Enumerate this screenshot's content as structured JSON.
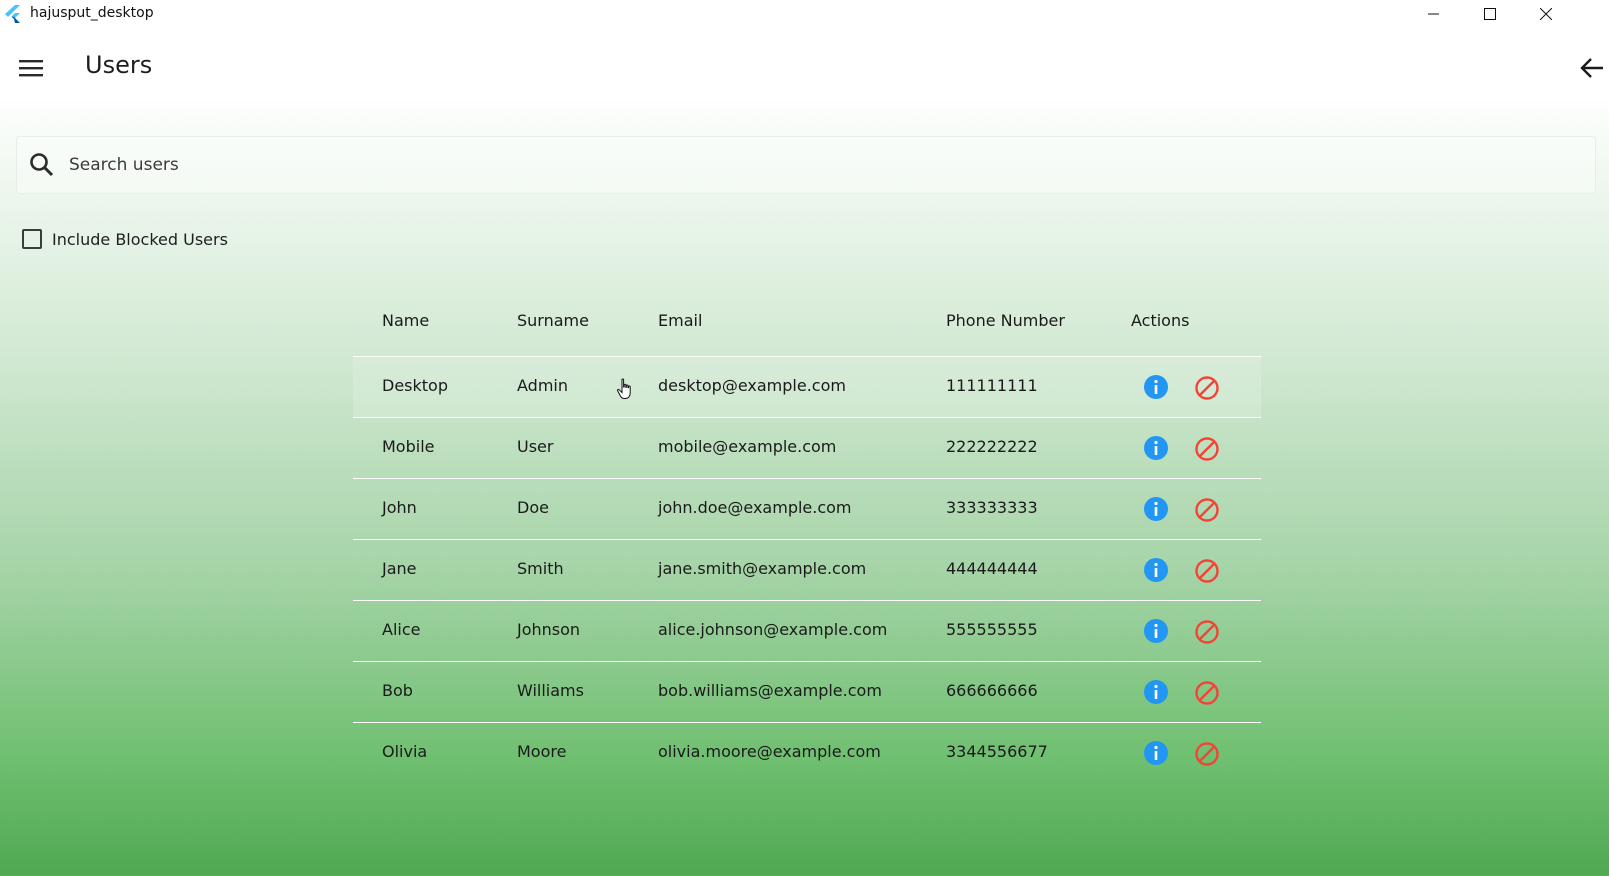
{
  "window": {
    "title": "hajusput_desktop"
  },
  "appbar": {
    "title": "Users"
  },
  "search": {
    "placeholder": "Search users",
    "value": ""
  },
  "filter": {
    "include_blocked_label": "Include Blocked Users",
    "checked": false
  },
  "table": {
    "headers": {
      "name": "Name",
      "surname": "Surname",
      "email": "Email",
      "phone": "Phone Number",
      "actions": "Actions"
    },
    "rows": [
      {
        "name": "Desktop",
        "surname": "Admin",
        "email": "desktop@example.com",
        "phone": "111111111"
      },
      {
        "name": "Mobile",
        "surname": "User",
        "email": "mobile@example.com",
        "phone": "222222222"
      },
      {
        "name": "John",
        "surname": "Doe",
        "email": "john.doe@example.com",
        "phone": "333333333"
      },
      {
        "name": "Jane",
        "surname": "Smith",
        "email": "jane.smith@example.com",
        "phone": "444444444"
      },
      {
        "name": "Alice",
        "surname": "Johnson",
        "email": "alice.johnson@example.com",
        "phone": "555555555"
      },
      {
        "name": "Bob",
        "surname": "Williams",
        "email": "bob.williams@example.com",
        "phone": "666666666"
      },
      {
        "name": "Olivia",
        "surname": "Moore",
        "email": "olivia.moore@example.com",
        "phone": "3344556677"
      }
    ]
  },
  "colors": {
    "info": "#2196f3",
    "block": "#f44336",
    "gradient_bottom": "#4fa852"
  },
  "icons": {
    "menu": "hamburger-icon",
    "back": "arrow-back-icon",
    "search": "search-icon",
    "info": "info-icon",
    "block": "block-icon"
  }
}
